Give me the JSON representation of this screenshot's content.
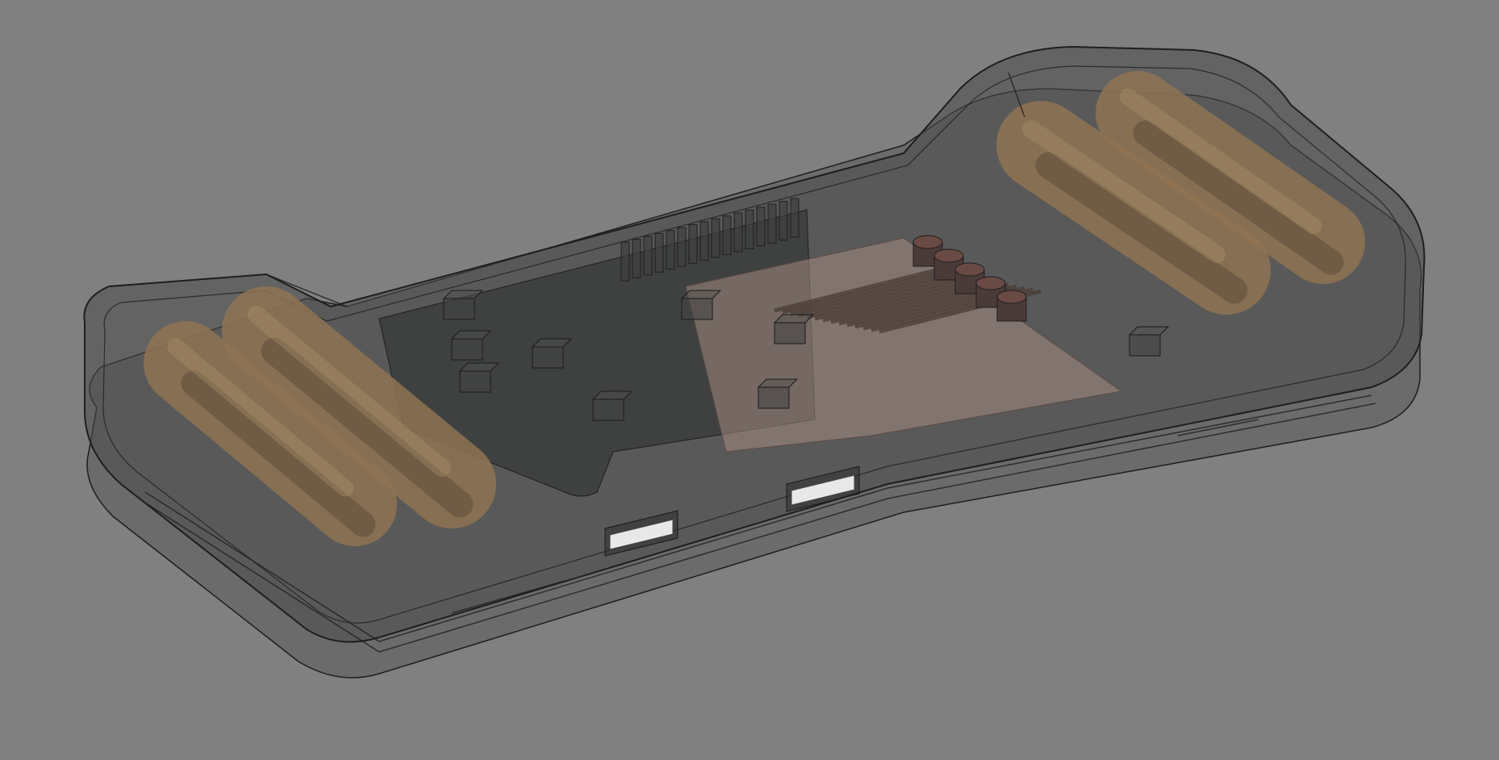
{
  "viewport": {
    "background_color": "#808080"
  },
  "model": {
    "render_mode": "transparent-wireframe",
    "colors": {
      "shell": "#4a4a4a",
      "shell_edge": "#1e1e1e",
      "board": "#3a3d3c",
      "copper_plate": "#a48a80",
      "battery": "#8f7352",
      "battery_shadow": "#5a4a38",
      "capacitor": "#4a3a38",
      "slot_highlight": "#e8e8e8"
    },
    "batteries": 4,
    "capacitors": 5,
    "heatsink_fins": 14,
    "usb_slots": 2,
    "board_chips": 9
  }
}
